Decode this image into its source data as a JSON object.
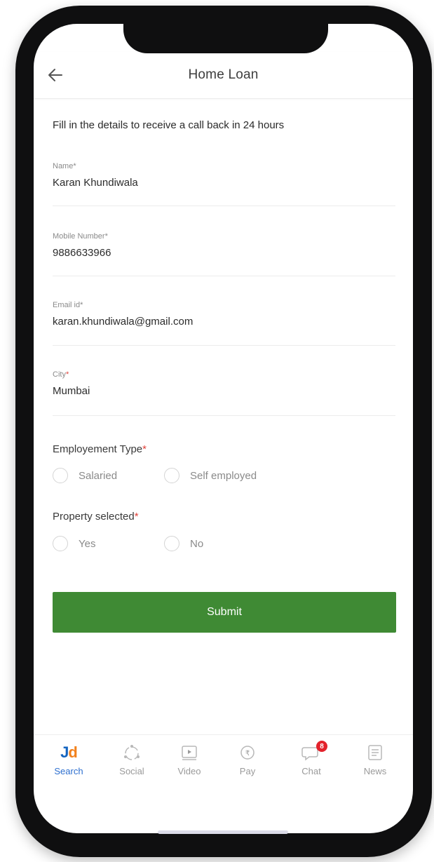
{
  "header": {
    "title": "Home Loan"
  },
  "intro": "Fill in the details to receive a call back in 24 hours",
  "fields": [
    {
      "label": "Name",
      "value": "Karan Khundiwala"
    },
    {
      "label": "Mobile Number",
      "value": "9886633966"
    },
    {
      "label": "Email id",
      "value": "karan.khundiwala@gmail.com"
    },
    {
      "label": "City",
      "value": "Mumbai"
    }
  ],
  "required_mark": "*",
  "employment": {
    "title": "Employement Type",
    "options": [
      "Salaried",
      "Self employed"
    ]
  },
  "property": {
    "title": "Property selected",
    "options": [
      "Yes",
      "No"
    ]
  },
  "submit_label": "Submit",
  "tabs": [
    {
      "label": "Search",
      "icon": "jd-logo",
      "logo_j": "J",
      "logo_d": "d"
    },
    {
      "label": "Social",
      "icon": "social-icon"
    },
    {
      "label": "Video",
      "icon": "video-icon"
    },
    {
      "label": "Pay",
      "icon": "rupee-icon"
    },
    {
      "label": "Chat",
      "icon": "chat-icon",
      "badge": "8"
    },
    {
      "label": "News",
      "icon": "news-icon"
    }
  ],
  "colors": {
    "submit": "#3f8a34",
    "required": "#e0433b",
    "active_tab": "#2d6fcf",
    "badge": "#e3222b"
  }
}
